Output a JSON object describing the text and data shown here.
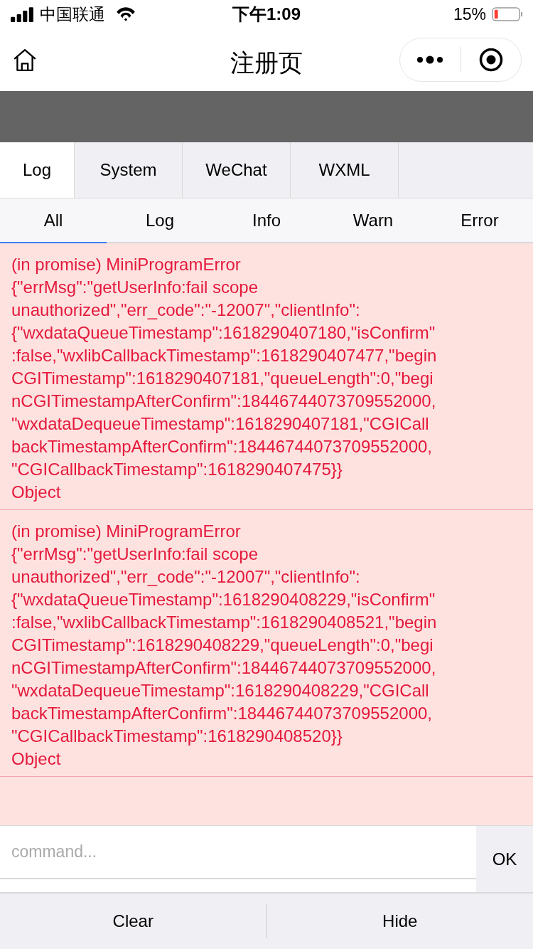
{
  "status_bar": {
    "carrier": "中国联通",
    "time": "下午1:09",
    "battery": "15%"
  },
  "nav": {
    "title": "注册页"
  },
  "tabs": [
    {
      "label": "Log",
      "selected": true
    },
    {
      "label": "System",
      "selected": false
    },
    {
      "label": "WeChat",
      "selected": false
    },
    {
      "label": "WXML",
      "selected": false
    }
  ],
  "filters": [
    {
      "label": "All",
      "selected": true
    },
    {
      "label": "Log",
      "selected": false
    },
    {
      "label": "Info",
      "selected": false
    },
    {
      "label": "Warn",
      "selected": false
    },
    {
      "label": "Error",
      "selected": false
    }
  ],
  "log_entries": [
    {
      "kind": "error",
      "heading": "(in promise) MiniProgramError",
      "message": "{\"errMsg\":\"getUserInfo:fail scope unauthorized\",\"err_code\":\"-12007\",\"clientInfo\":{\"wxdataQueueTimestamp\":1618290407180,\"isConfirm\":false,\"wxlibCallbackTimestamp\":1618290407477,\"beginCGITimestamp\":1618290407181,\"queueLength\":0,\"beginCGITimestampAfterConfirm\":18446744073709552000,\"wxdataDequeueTimestamp\":1618290407181,\"CGICallbackTimestampAfterConfirm\":18446744073709552000,\"CGICallbackTimestamp\":1618290407475}}",
      "object": "Object"
    },
    {
      "kind": "error",
      "heading": "(in promise) MiniProgramError",
      "message": "{\"errMsg\":\"getUserInfo:fail scope unauthorized\",\"err_code\":\"-12007\",\"clientInfo\":{\"wxdataQueueTimestamp\":1618290408229,\"isConfirm\":false,\"wxlibCallbackTimestamp\":1618290408521,\"beginCGITimestamp\":1618290408229,\"queueLength\":0,\"beginCGITimestampAfterConfirm\":18446744073709552000,\"wxdataDequeueTimestamp\":1618290408229,\"CGICallbackTimestampAfterConfirm\":18446744073709552000,\"CGICallbackTimestamp\":1618290408520}}",
      "object": "Object"
    }
  ],
  "command": {
    "placeholder": "command...",
    "button": "OK"
  },
  "footer_buttons": [
    "Clear",
    "Hide"
  ]
}
